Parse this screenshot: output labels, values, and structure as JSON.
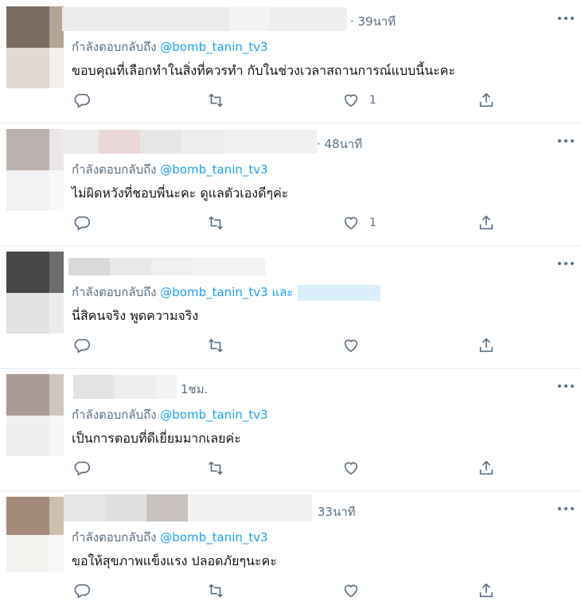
{
  "reply_prefix": "กำลังตอบกลับถึง",
  "tweets": [
    {
      "time": "· 39นาที",
      "handle": "@bomb_tanin_tv3",
      "text": "ขอบคุณที่เลือกทำในสิ่งที่ควรทำ กับในช่วงเวลาสถานการณ์แบบนี้นะคะ",
      "like_count": "1"
    },
    {
      "time": "· 48นาที",
      "handle": "@bomb_tanin_tv3",
      "text": "ไม่ผิดหวังที่ชอบพี่นะคะ ดูแลตัวเองดีๆค่ะ",
      "like_count": "1"
    },
    {
      "time": "",
      "handle": "@bomb_tanin_tv3",
      "and_label": "และ",
      "text": "นี่สิคนจริง พูดความจริง",
      "like_count": ""
    },
    {
      "time": "1ชม.",
      "handle": "@bomb_tanin_tv3",
      "text": "เป็นการตอบที่ดีเยี่ยมมากเลยค่ะ",
      "like_count": ""
    },
    {
      "time": "33นาที",
      "handle": "@bomb_tanin_tv3",
      "text": "ขอให้สุขภาพแข็งแรง ปลอดภัยๆนะคะ",
      "like_count": ""
    }
  ],
  "icons": {
    "reply": "reply-icon",
    "retweet": "retweet-icon",
    "like": "heart-icon",
    "share": "share-icon",
    "more": "more-icon"
  },
  "colors": {
    "secondary_text": "#5b7083",
    "link": "#1da1f2",
    "divider": "#e6ecf0"
  }
}
